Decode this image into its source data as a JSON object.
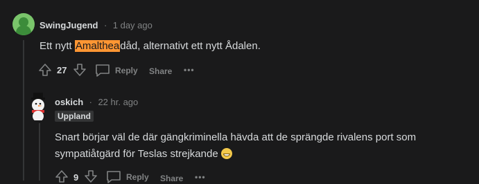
{
  "comments": [
    {
      "username": "SwingJugend",
      "time": "1 day ago",
      "text_before": "Ett nytt ",
      "highlight": "Amalthea",
      "text_after": "dåd, alternativt ett nytt Ådalen.",
      "votes": "27",
      "reply_label": "Reply",
      "share_label": "Share",
      "more_label": "•••"
    },
    {
      "username": "oskich",
      "time": "22 hr. ago",
      "flair": "Uppland",
      "text_line1": "Snart börjar väl de där gängkriminella hävda att de sprängde rivalens port som",
      "text_line2": "sympatiåtgärd för Teslas strejkande",
      "votes": "9",
      "reply_label": "Reply",
      "share_label": "Share",
      "more_label": "•••"
    }
  ],
  "separator": "·",
  "colors": {
    "background": "#1a1a1b",
    "highlight": "#ff9633",
    "muted": "#818384",
    "text": "#d7dadc"
  }
}
